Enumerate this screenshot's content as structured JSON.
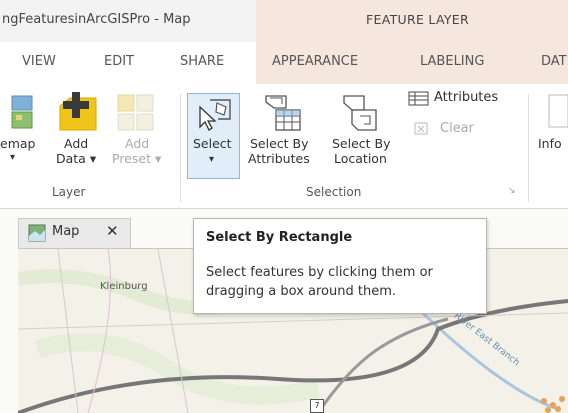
{
  "window": {
    "title": "ngFeaturesinArcGISPro - Map",
    "context_tab": "FEATURE LAYER"
  },
  "tabs": [
    {
      "label": "VIEW"
    },
    {
      "label": "EDIT"
    },
    {
      "label": "SHARE"
    },
    {
      "label": "APPEARANCE"
    },
    {
      "label": "LABELING"
    },
    {
      "label": "DAT"
    }
  ],
  "ribbon": {
    "layer_group": {
      "label": "Layer",
      "basemap_label": "emap",
      "add_data_line1": "Add",
      "add_data_line2": "Data ▾",
      "add_preset_line1": "Add",
      "add_preset_line2": "Preset ▾"
    },
    "selection_group": {
      "label": "Selection",
      "select_label": "Select",
      "select_arrow": "▾",
      "by_attributes_line1": "Select By",
      "by_attributes_line2": "Attributes",
      "by_location_line1": "Select By",
      "by_location_line2": "Location",
      "attributes_label": "Attributes",
      "clear_label": "Clear",
      "launcher": "↘"
    },
    "info_label": "Info"
  },
  "map": {
    "tab_label": "Map",
    "close_glyph": "✕",
    "place_label": "Kleinburg",
    "river_label": "River East Branch",
    "route_marker": "7"
  },
  "tooltip": {
    "title": "Select By Rectangle",
    "description": "Select features by clicking them or dragging a box around them."
  },
  "colors": {
    "context_tab_bg": "#f6e7de",
    "select_highlight": "#e1eef9",
    "add_data_yellow": "#f0c419"
  }
}
